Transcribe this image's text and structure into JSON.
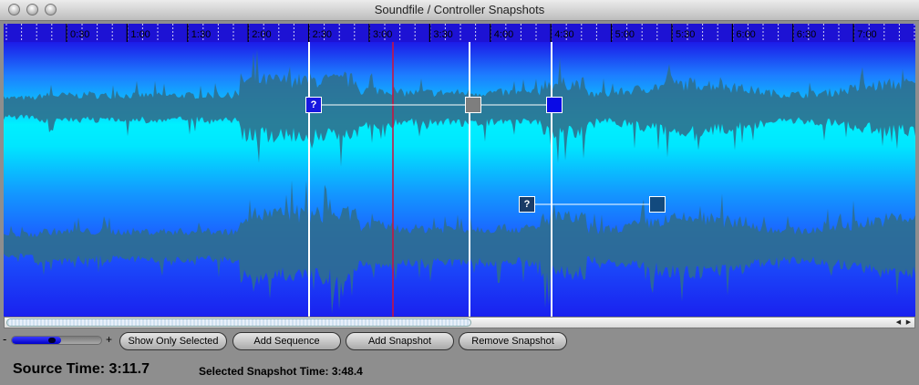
{
  "window": {
    "title": "Soundfile / Controller Snapshots"
  },
  "ruler": {
    "labels": [
      "0:30",
      "1:00",
      "1:30",
      "2:00",
      "2:30",
      "3:00",
      "3:30",
      "4:00",
      "4:30",
      "5:00",
      "5:30",
      "6:00",
      "6:30",
      "7:00"
    ]
  },
  "snapshots": {
    "top": {
      "marker_1": "?",
      "marker_2": "",
      "marker_3": ""
    },
    "bottom": {
      "marker_1": "?",
      "marker_2": ""
    }
  },
  "zoom": {
    "minus": "-",
    "plus": "+",
    "level": 0.55
  },
  "buttons": {
    "show_only_selected": "Show Only Selected",
    "add_sequence": "Add Sequence",
    "add_snapshot": "Add Snapshot",
    "remove_snapshot": "Remove Snapshot"
  },
  "status": {
    "source_time": "Source Time: 3:11.7",
    "selected_snapshot_time": "Selected Snapshot Time: 3:48.4"
  },
  "colors": {
    "ruler_bg": "#1d12d4",
    "wave_top": "#1c1be8",
    "wave_mid": "#00f0ff",
    "waveform": "#2f6e8c",
    "playhead": "#d0103a"
  }
}
